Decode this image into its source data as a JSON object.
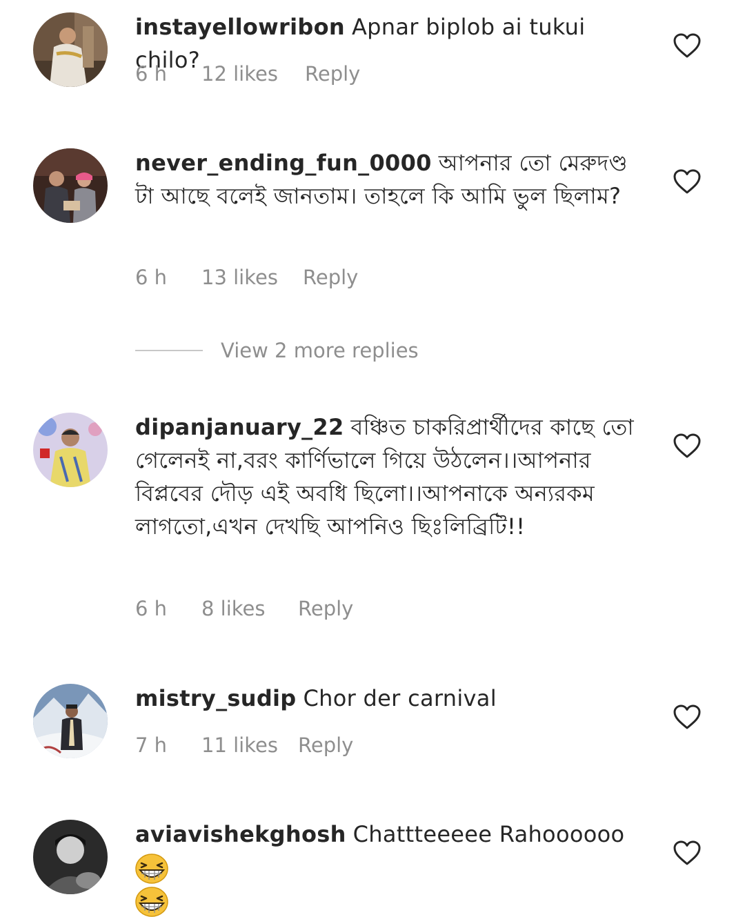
{
  "comments": [
    {
      "username": "instayellowribon",
      "text": "Apnar biplob ai tukui chilo?",
      "time": "6 h",
      "likes": "12 likes",
      "reply": "Reply"
    },
    {
      "username": "never_ending_fun_0000",
      "text": "আপনার তো মেরুদণ্ড টা আছে বলেই জানতাম। তাহলে কি আমি ভুল ছিলাম?",
      "time": "6 h",
      "likes": "13 likes",
      "reply": "Reply"
    },
    {
      "username": "dipanjanuary_22",
      "text": "বঞ্চিত চাকরিপ্রার্থীদের কাছে তো গেলেনই না,বরং কার্ণিভালে গিয়ে উঠলেন।।আপনার বিপ্লবের দৌড় এই অবধি ছিলো।।আপনাকে অন্যরকম লাগতো,এখন দেখছি আপনিও ছিঃলিব্রিটি!!",
      "time": "6 h",
      "likes": "8 likes",
      "reply": "Reply"
    },
    {
      "username": "mistry_sudip",
      "text": "Chor der carnival",
      "time": "7 h",
      "likes": "11 likes",
      "reply": "Reply"
    },
    {
      "username": "aviavishekghosh",
      "text": "Chattteeeee Rahoooooo",
      "time": "",
      "likes": "",
      "reply": ""
    }
  ],
  "view_more_replies": "View 2 more replies",
  "icons": {
    "like": "heart-outline-icon",
    "emoji": "grinning-squinting-face-emoji"
  },
  "colors": {
    "text": "#262626",
    "secondary": "#8e8e8e",
    "divider": "#c7c7c7"
  }
}
